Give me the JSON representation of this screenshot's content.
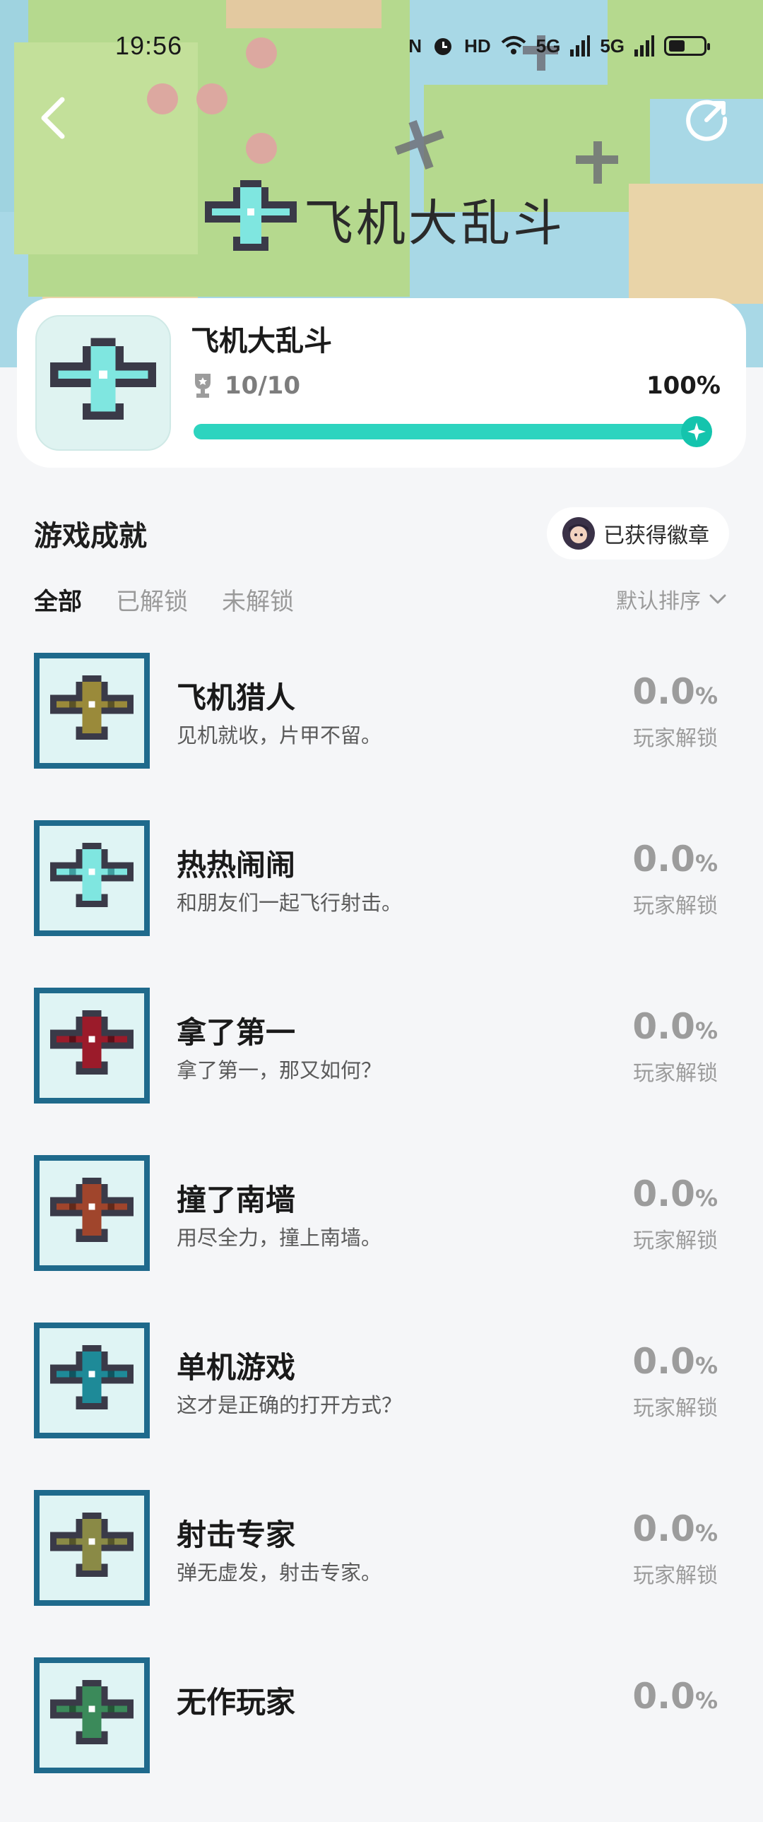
{
  "status_bar": {
    "time": "19:56",
    "nfc": "N",
    "hd": "HD",
    "net1": "5G",
    "net2": "5G"
  },
  "hero": {
    "title": "飞机大乱斗"
  },
  "game": {
    "name": "飞机大乱斗",
    "trophy_count": "10/10",
    "progress_label": "100%",
    "progress_fraction": 1.0
  },
  "section": {
    "title": "游戏成就",
    "badge_button": "已获得徽章"
  },
  "tabs": [
    {
      "label": "全部",
      "active": true
    },
    {
      "label": "已解锁",
      "active": false
    },
    {
      "label": "未解锁",
      "active": false
    }
  ],
  "sort_label": "默认排序",
  "achievements": [
    {
      "title": "飞机猎人",
      "desc": "见机就收，片甲不留。",
      "rate": "0.0",
      "unit": "%",
      "caption": "玩家解锁",
      "plane_color": "#9a8a3a",
      "plane_dark": "#5b5326"
    },
    {
      "title": "热热闹闹",
      "desc": "和朋友们一起飞行射击。",
      "rate": "0.0",
      "unit": "%",
      "caption": "玩家解锁",
      "plane_color": "#7fe6e0",
      "plane_dark": "#3f9fa0"
    },
    {
      "title": "拿了第一",
      "desc": "拿了第一，那又如何？",
      "rate": "0.0",
      "unit": "%",
      "caption": "玩家解锁",
      "plane_color": "#9b1b2a",
      "plane_dark": "#5c0f18"
    },
    {
      "title": "撞了南墙",
      "desc": "用尽全力，撞上南墙。",
      "rate": "0.0",
      "unit": "%",
      "caption": "玩家解锁",
      "plane_color": "#a0452c",
      "plane_dark": "#62291a"
    },
    {
      "title": "单机游戏",
      "desc": "这才是正确的打开方式？",
      "rate": "0.0",
      "unit": "%",
      "caption": "玩家解锁",
      "plane_color": "#1e8a98",
      "plane_dark": "#0f5560"
    },
    {
      "title": "射击专家",
      "desc": "弹无虚发，射击专家。",
      "rate": "0.0",
      "unit": "%",
      "caption": "玩家解锁",
      "plane_color": "#8a8a46",
      "plane_dark": "#55552a"
    },
    {
      "title": "无作玩家",
      "desc": "",
      "rate": "0.0",
      "unit": "%",
      "caption": "",
      "plane_color": "#3b8a5a",
      "plane_dark": "#245636"
    }
  ]
}
